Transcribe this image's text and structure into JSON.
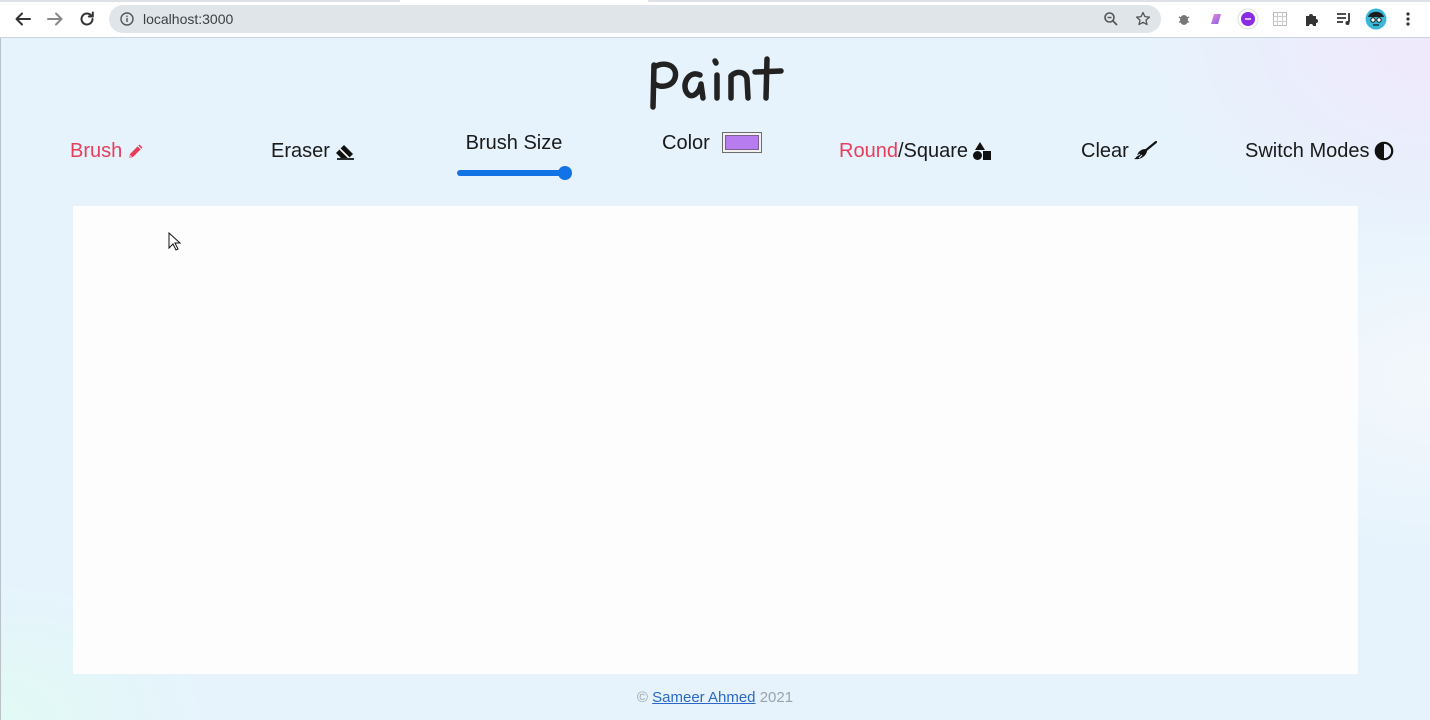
{
  "browser": {
    "url": "localhost:3000"
  },
  "app": {
    "title": "Paint"
  },
  "toolbar": {
    "brush_label": "Brush",
    "eraser_label": "Eraser",
    "brush_size_label": "Brush Size",
    "brush_size_value": 1.0,
    "color_label": "Color",
    "color_value": "#b67cf0",
    "round_label": "Round",
    "separator": "/",
    "square_label": "Square",
    "clear_label": "Clear",
    "switch_modes_label": "Switch Modes"
  },
  "footer": {
    "copyright": "©",
    "author": "Sameer Ahmed",
    "year": "2021"
  },
  "colors": {
    "active_tool": "#e83e5a",
    "slider_accent": "#1273e6",
    "canvas_bg": "#fdfdfd",
    "page_bg": "#e6f3fc"
  }
}
